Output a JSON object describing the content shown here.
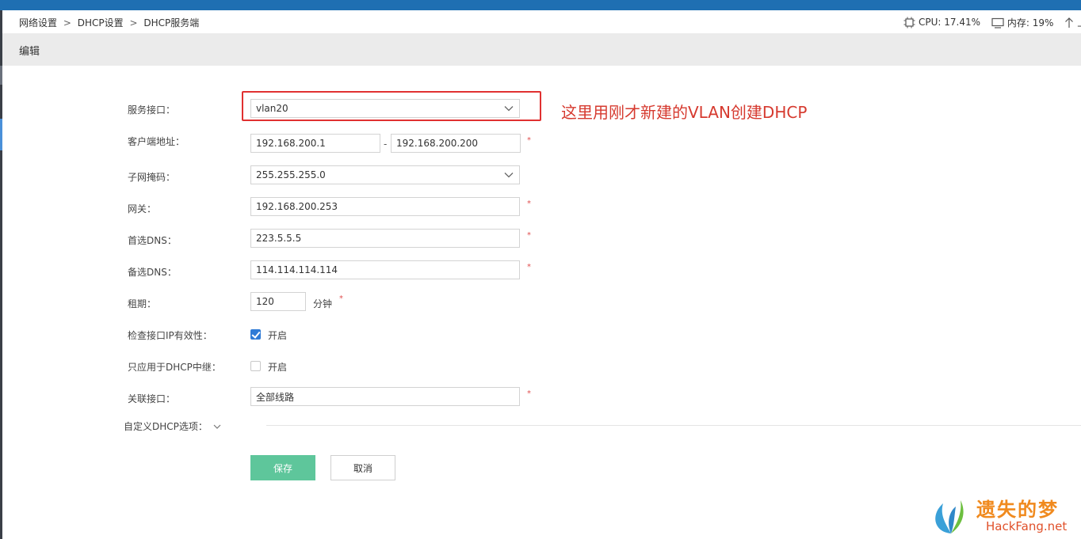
{
  "colors": {
    "topbar": "#1f6fb2",
    "save_button": "#5ec69b",
    "highlight": "#e03030",
    "annotation": "#d63a2f",
    "required": "#e05050"
  },
  "breadcrumb": {
    "items": [
      "网络设置",
      "DHCP设置",
      "DHCP服务端"
    ],
    "separator": ">"
  },
  "stats": {
    "cpu": "CPU: 17.41%",
    "memory": "内存: 19%",
    "upload": "上"
  },
  "edit_bar": {
    "title": "编辑"
  },
  "form": {
    "service_interface": {
      "label": "服务接口：",
      "value": "vlan20"
    },
    "client_address": {
      "label": "客户端地址：",
      "start": "192.168.200.1",
      "dash": "-",
      "end": "192.168.200.200"
    },
    "subnet_mask": {
      "label": "子网掩码：",
      "value": "255.255.255.0"
    },
    "gateway": {
      "label": "网关：",
      "value": "192.168.200.253"
    },
    "primary_dns": {
      "label": "首选DNS：",
      "value": "223.5.5.5"
    },
    "secondary_dns": {
      "label": "备选DNS：",
      "value": "114.114.114.114"
    },
    "lease": {
      "label": "租期：",
      "value": "120",
      "unit": "分钟"
    },
    "check_ip": {
      "label": "检查接口IP有效性：",
      "option": "开启",
      "checked": true
    },
    "relay_only": {
      "label": "只应用于DHCP中继：",
      "option": "开启",
      "checked": false
    },
    "linked_interface": {
      "label": "关联接口：",
      "value": "全部线路"
    },
    "custom_options": {
      "label": "自定义DHCP选项："
    },
    "required_mark": "*"
  },
  "buttons": {
    "save": "保存",
    "cancel": "取消"
  },
  "annotation": {
    "text": "这里用刚才新建的VLAN创建DHCP"
  },
  "watermark": {
    "title": "遗失的梦",
    "site": "HackFang.net"
  },
  "icons": {
    "cpu": "chip-icon",
    "memory": "monitor-icon",
    "upload": "arrow-up-icon",
    "dropdown": "chevron-down-icon"
  }
}
